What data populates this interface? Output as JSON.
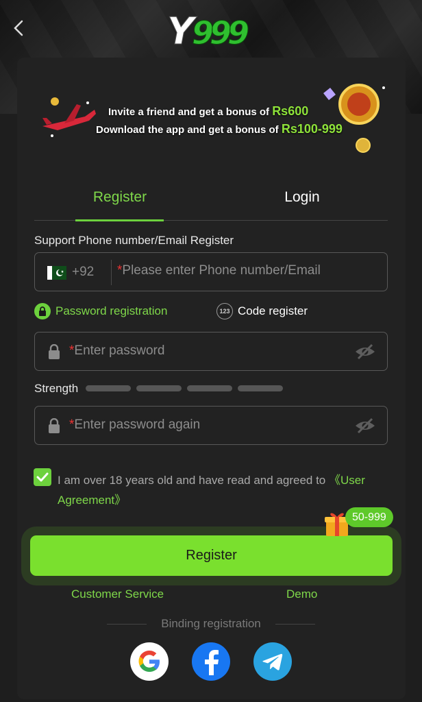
{
  "header": {
    "back_icon": "chevron-left-icon",
    "logo_text": "Y999"
  },
  "banner": {
    "line1_text": "Invite a friend and get a bonus of ",
    "line1_amount": "Rs600",
    "line2_text": "Download the app and get a bonus of ",
    "line2_amount": "Rs100-999"
  },
  "tabs": [
    {
      "label": "Register",
      "active": true
    },
    {
      "label": "Login",
      "active": false
    }
  ],
  "form": {
    "support_label": "Support Phone number/Email Register",
    "country_code": "+92",
    "phone_placeholder": "Please enter Phone number/Email",
    "required_mark": "*",
    "option_password": "Password registration",
    "option_code": "Code register",
    "code_icon_text": "123",
    "password_placeholder": "Enter password",
    "strength_label": "Strength",
    "strength_segments": 4,
    "password_again_placeholder": "Enter password again",
    "agreement_text": "I am over 18 years old and have read and agreed to ",
    "agreement_link": "《User Agreement》",
    "agreement_checked": true
  },
  "actions": {
    "register_label": "Register",
    "bonus_badge": "50-999",
    "customer_service": "Customer Service",
    "demo": "Demo"
  },
  "binding": {
    "label": "Binding registration",
    "providers": [
      "google-icon",
      "facebook-icon",
      "telegram-icon"
    ]
  },
  "colors": {
    "accent": "#7ae02e",
    "background": "#1e1e1e",
    "card": "#222222",
    "required": "#e33333"
  }
}
